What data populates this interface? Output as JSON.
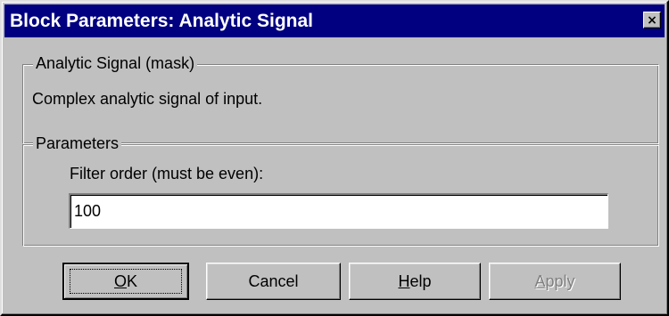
{
  "window": {
    "title": "Block Parameters: Analytic Signal",
    "close_glyph": "×"
  },
  "mask_group": {
    "legend": "Analytic Signal (mask)",
    "description": "Complex analytic signal of input."
  },
  "params_group": {
    "legend": "Parameters",
    "filter_order_label": "Filter order (must be even):",
    "filter_order_value": "100"
  },
  "buttons": {
    "ok": {
      "mnemonic": "O",
      "rest": "K"
    },
    "cancel": "Cancel",
    "help": {
      "mnemonic": "H",
      "rest": "elp"
    },
    "apply": {
      "mnemonic": "A",
      "rest": "pply"
    }
  },
  "colors": {
    "titlebar": "#000080",
    "face": "#c0c0c0",
    "disabled_text": "#808080"
  }
}
